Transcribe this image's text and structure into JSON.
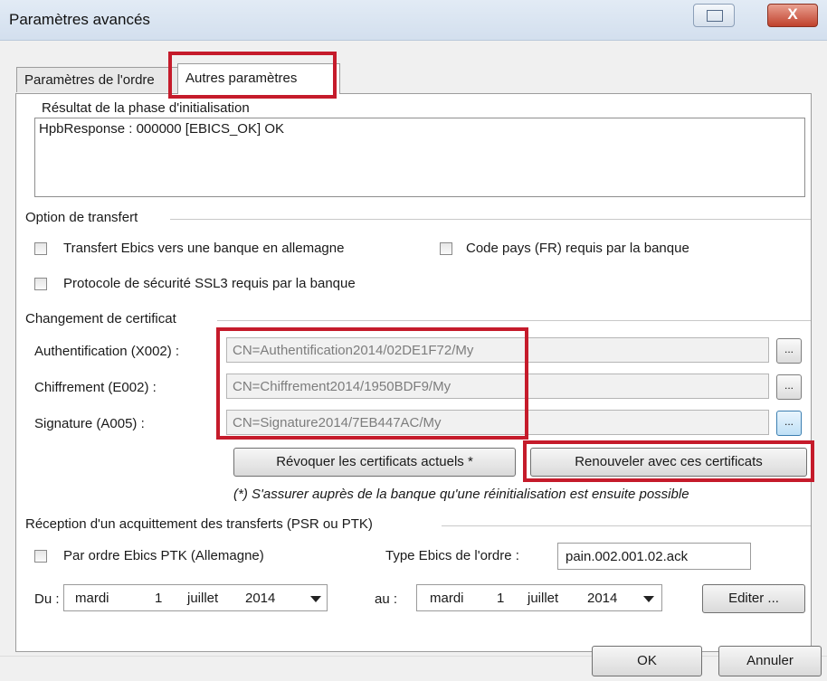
{
  "window": {
    "title": "Paramètres avancés",
    "close_glyph": "X",
    "restore_icon": "restore-icon"
  },
  "tabs": [
    {
      "label": "Paramètres de l'ordre"
    },
    {
      "label": "Autres paramètres"
    }
  ],
  "init": {
    "label": "Résultat de la phase d'initialisation",
    "value": "HpbResponse : 000000 [EBICS_OK] OK"
  },
  "transfer": {
    "group_label": "Option de transfert",
    "cb_germany": "Transfert Ebics vers une banque en allemagne",
    "cb_country_code": "Code pays (FR) requis par la banque",
    "cb_ssl3": "Protocole de sécurité SSL3 requis par la banque"
  },
  "certificates": {
    "group_label": "Changement de certificat",
    "auth_label": "Authentification (X002) :",
    "auth_value": "CN=Authentification2014/02DE1F72/My",
    "enc_label": "Chiffrement (E002) :",
    "enc_value": "CN=Chiffrement2014/1950BDF9/My",
    "sig_label": "Signature (A005) :",
    "sig_value": "CN=Signature2014/7EB447AC/My",
    "browse_label": "...",
    "revoke_button": "Révoquer les certificats actuels *",
    "renew_button": "Renouveler avec ces certificats",
    "note": "(*) S'assurer auprès de la banque qu'une réinitialisation est ensuite possible"
  },
  "ack": {
    "group_label": "Réception d'un acquittement des transferts (PSR ou PTK)",
    "cb_ptk": "Par ordre Ebics PTK (Allemagne)",
    "type_label": "Type Ebics de l'ordre :",
    "type_value": "pain.002.001.02.ack",
    "from_label": "Du :",
    "from_date": {
      "weekday": "mardi",
      "day": "1",
      "month": "juillet",
      "year": "2014"
    },
    "to_label": "au :",
    "to_date": {
      "weekday": "mardi",
      "day": "1",
      "month": "juillet",
      "year": "2014"
    },
    "edit_button": "Editer ..."
  },
  "footer": {
    "ok_button": "OK",
    "cancel_button": "Annuler"
  },
  "colors": {
    "highlight_border": "#c51b2b",
    "title_bar": "#dbe6f2",
    "close_button": "#c0412c"
  }
}
